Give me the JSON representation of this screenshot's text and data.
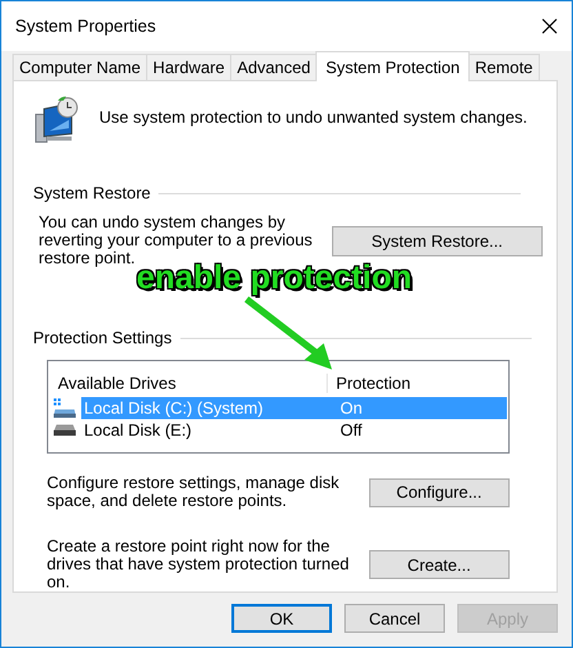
{
  "window": {
    "title": "System Properties"
  },
  "tabs": [
    {
      "label": "Computer Name",
      "selected": false
    },
    {
      "label": "Hardware",
      "selected": false
    },
    {
      "label": "Advanced",
      "selected": false
    },
    {
      "label": "System Protection",
      "selected": true
    },
    {
      "label": "Remote",
      "selected": false
    }
  ],
  "intro": "Use system protection to undo unwanted system changes.",
  "system_restore": {
    "heading": "System Restore",
    "text": "You can undo system changes by reverting your computer to a previous restore point.",
    "button": "System Restore..."
  },
  "annotation": {
    "text": "enable protection"
  },
  "protection_settings": {
    "heading": "Protection Settings",
    "columns": [
      "Available Drives",
      "Protection"
    ],
    "drives": [
      {
        "kind": "system",
        "name": "Local Disk (C:) (System)",
        "protection": "On",
        "selected": true
      },
      {
        "kind": "drive",
        "name": "Local Disk (E:)",
        "protection": "Off",
        "selected": false
      }
    ],
    "configure": {
      "text": "Configure restore settings, manage disk space, and delete restore points.",
      "button": "Configure..."
    },
    "create": {
      "text": "Create a restore point right now for the drives that have system protection turned on.",
      "button": "Create..."
    }
  },
  "buttons": [
    {
      "label": "OK",
      "default": true,
      "disabled": false
    },
    {
      "label": "Cancel",
      "default": false,
      "disabled": false
    },
    {
      "label": "Apply",
      "default": false,
      "disabled": true
    }
  ]
}
